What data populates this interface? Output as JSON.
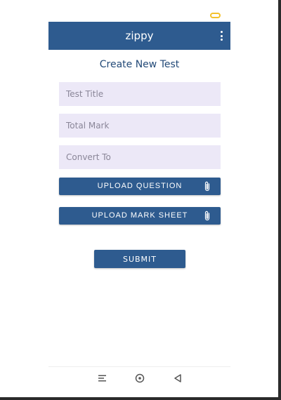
{
  "colors": {
    "primary": "#2e5b8f",
    "field_bg": "#ece8f7",
    "heading": "#234a78"
  },
  "appbar": {
    "title": "zippy",
    "menu_icon": "more-vert-icon"
  },
  "form": {
    "heading": "Create New Test",
    "test_title_placeholder": "Test Title",
    "total_mark_placeholder": "Total Mark",
    "convert_to_placeholder": "Convert To",
    "upload_question_label": "Upload Question",
    "upload_mark_sheet_label": "Upload Mark Sheet",
    "submit_label": "Submit"
  },
  "navbar": {
    "icons": [
      "menu-icon",
      "home-circle-icon",
      "back-triangle-icon"
    ]
  }
}
